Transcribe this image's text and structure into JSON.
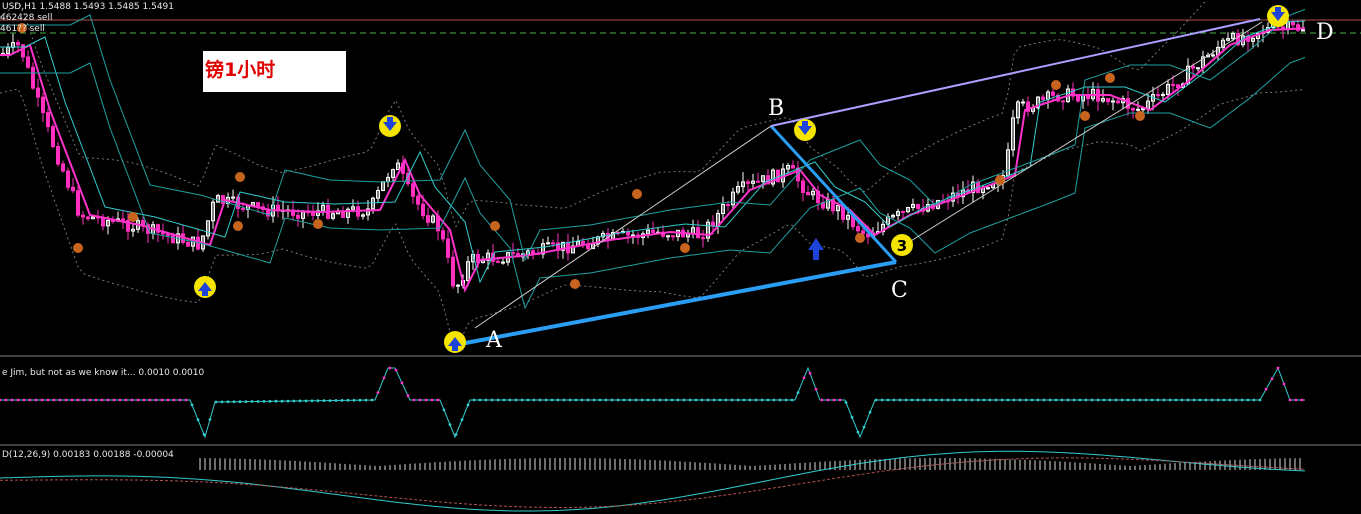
{
  "header": {
    "symbol_line": "USD,H1  1.5488  1.5493  1.5485  1.5491",
    "order_line_1": "462428 sell",
    "order_line_2": "461?? sell"
  },
  "label_box": {
    "text": "镑1小时"
  },
  "wave_labels": [
    "A",
    "B",
    "C",
    "D"
  ],
  "marker_number": "3",
  "indicator_1": {
    "title": "e Jim, but not as we know it...  0.0010 0.0010"
  },
  "indicator_2": {
    "title": "D(12,26,9) 0.00183 0.00188 -0.00004"
  },
  "colors": {
    "background": "#000000",
    "bull_candle": "#ffffff",
    "bear_candle": "#ff2fc0",
    "magenta_ma": "#ff33cc",
    "cyan_ma": "#33cccc",
    "teal_ma": "#20a0a0",
    "bands": "#777777",
    "trend_blue": "#2a9df4",
    "trend_lavender": "#a9a0ff",
    "arrow_yellow": "#f4e400",
    "arrow_blue": "#1d43d9",
    "fractal_orange": "#c8641e",
    "hline_red": "#b05050",
    "hline_green": "#4caf50"
  },
  "chart_data": [
    {
      "type": "candlestick",
      "title": "USD,H1",
      "quote": {
        "open": 1.5488,
        "high": 1.5493,
        "low": 1.5485,
        "close": 1.5491
      },
      "annotations": [
        "A",
        "B",
        "C",
        "D",
        "3",
        "镑1小时"
      ],
      "signals": [
        "up-arrow at A",
        "down-arrow at B",
        "down-arrow at D",
        "up-arrow at left low"
      ]
    },
    {
      "type": "line",
      "title": "e Jim, but not as we know it...",
      "values": [
        0.001,
        0.001
      ]
    },
    {
      "type": "line",
      "title": "D(12,26,9)",
      "values": [
        0.00183,
        0.00188,
        -4e-05
      ],
      "series": [
        {
          "name": "MACD"
        },
        {
          "name": "Signal"
        },
        {
          "name": "Histogram"
        }
      ]
    }
  ]
}
